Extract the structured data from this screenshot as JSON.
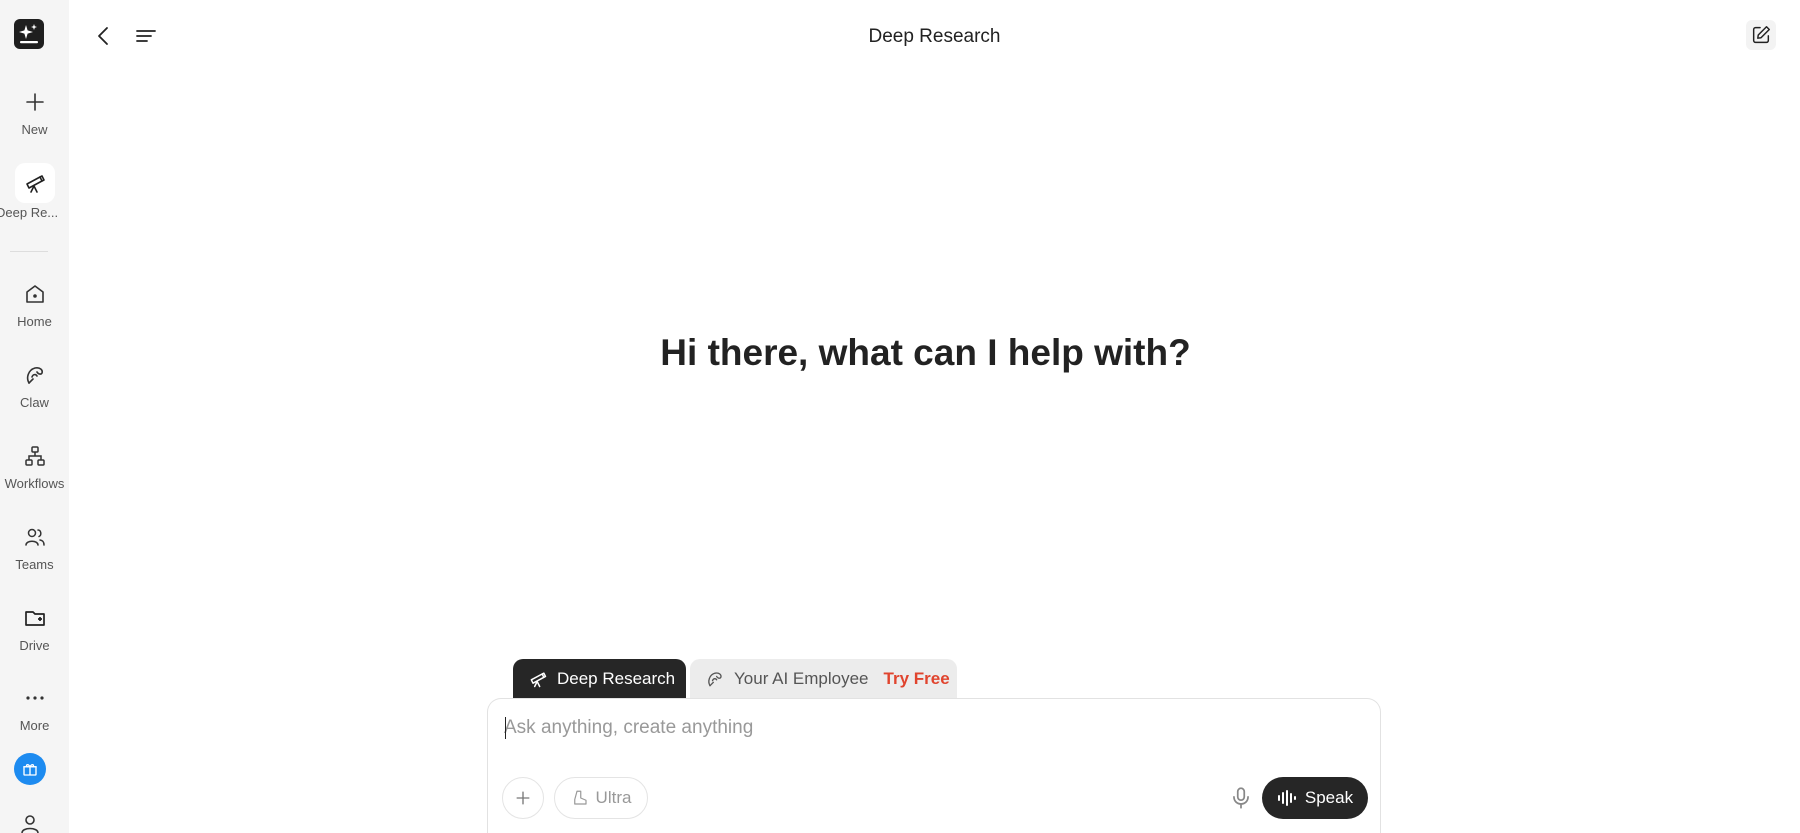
{
  "sidebar": {
    "logo_icon": "sparkle-logo-icon",
    "items": [
      {
        "label": "New",
        "icon": "plus-icon"
      },
      {
        "label": "Deep Re...",
        "icon": "telescope-icon"
      },
      {
        "label": "Home",
        "icon": "home-icon"
      },
      {
        "label": "Claw",
        "icon": "claw-icon"
      },
      {
        "label": "Workflows",
        "icon": "workflow-icon"
      },
      {
        "label": "Teams",
        "icon": "users-icon"
      },
      {
        "label": "Drive",
        "icon": "folder-icon"
      },
      {
        "label": "More",
        "icon": "more-icon"
      }
    ],
    "gift_icon": "gift-icon",
    "user_icon": "user-icon"
  },
  "header": {
    "title": "Deep Research",
    "back_icon": "chevron-left-icon",
    "menu_icon": "menu-icon",
    "edit_icon": "edit-icon"
  },
  "main": {
    "greeting": "Hi there, what can I help with?"
  },
  "composer": {
    "tabs": [
      {
        "label": "Deep Research",
        "active": true
      },
      {
        "label": "Your AI Employee",
        "badge": "Try Free",
        "active": false
      }
    ],
    "placeholder": "Ask anything, create anything",
    "value": "",
    "ultra_label": "Ultra",
    "speak_label": "Speak"
  },
  "colors": {
    "sidebar_bg": "#f5f5f5",
    "dark": "#262626",
    "accent_blue": "#1d8bf0",
    "try_free_red": "#e0442e"
  }
}
